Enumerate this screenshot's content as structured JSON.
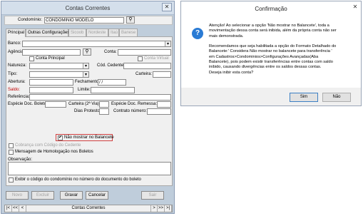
{
  "main_window": {
    "title": "Contas Correntes",
    "close_label": "✕",
    "condominio_label": "Condomínio:",
    "condominio_value": "CONDOMINIO MODELO",
    "tabs": [
      {
        "label": "Principal"
      },
      {
        "label": "Outras Configurações"
      },
      {
        "label": "Sicoob"
      },
      {
        "label": "Nordeste"
      },
      {
        "label": "Itaú"
      },
      {
        "label": "Banese"
      }
    ],
    "fields": {
      "banco": "Banco:",
      "agencia": "Agência:",
      "conta": "Conta:",
      "conta_principal": "Conta Principal",
      "conta_virtual": "Conta Virtual",
      "natureza": "Natureza:",
      "cod_cedente": "Cód. Cedente:",
      "tipo": "Tipo:",
      "carteira": "Carteira:",
      "abertura": "Abertura:",
      "fechamento": "Fechamento:",
      "fechamento_value": "/  /",
      "saldo": "Saldo:",
      "limite": "Limite:",
      "referencia": "Referência:",
      "especie_doc_boleto": "Espécie Doc. Boleto:",
      "carteira_2via": "Carteira (2ª Via):",
      "especie_doc_remessa": "Espécie Doc. Remessa:",
      "dias_protesto": "Dias Protesto:",
      "contrato_numero": "Contrato número:"
    },
    "checks": {
      "nao_mostrar": "Não mostrar no Balancete",
      "cobranca": "Cobrança com Código do Cedente",
      "homologacao": "Mensagem de Homologação nos Boletos",
      "exibir": "Exibir o código do condomínio no número do documento do boleto"
    },
    "observacao_label": "Observação:",
    "buttons": {
      "novo": "Novo",
      "excluir": "Excluir",
      "gravar": "Gravar",
      "cancelar": "Cancelar",
      "sair": "Sair"
    },
    "nav": {
      "first": "|<",
      "prev": "<<",
      "prev1": "<",
      "center": "Contas Correntes",
      "next1": ">",
      "next": ">>",
      "last": ">|"
    }
  },
  "dialog": {
    "title": "Confirmação",
    "close_label": "✕",
    "icon_glyph": "?",
    "lines": [
      "Atenção! Ao selecionar a opção 'Não mostrar no Balancete', toda a",
      "movimentação dessa conta será inibida, além da própria conta não ser",
      "mais demonstrada.",
      "",
      "Recomendamos que seja habilitada a opção do Formato Detalhado do",
      "Balancete:' Considera Não mostrar no balancete para transferência '",
      "em Cadastros>Condominios>Configurações Avançadas(Aba",
      "Balancete), pois podem existir transferências entre contas com saldo",
      "inibido, causando divergências entre os saldos dessas contas.",
      "Deseja inibir esta conta?"
    ],
    "yes_label": "Sim",
    "no_label": "Não"
  }
}
